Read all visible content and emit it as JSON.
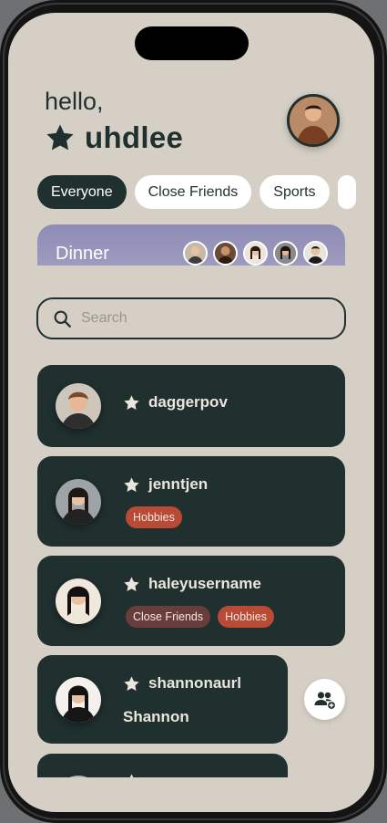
{
  "header": {
    "greeting": "hello,",
    "username": "uhdlee"
  },
  "colors": {
    "primary": "#1f302e",
    "background": "#d6cfc6",
    "group_card": "#9d9bbf",
    "tag_hobbies": "#b84a36",
    "tag_close_friends": "#6a3d3d"
  },
  "filters": [
    {
      "label": "Everyone",
      "active": true
    },
    {
      "label": "Close Friends",
      "active": false
    },
    {
      "label": "Sports",
      "active": false
    }
  ],
  "group_card": {
    "name": "Dinner"
  },
  "search": {
    "placeholder": "Search"
  },
  "friends": [
    {
      "username": "daggerpov",
      "tags": []
    },
    {
      "username": "jenntjen",
      "tags": [
        "Hobbies"
      ]
    },
    {
      "username": "haleyusername",
      "tags": [
        "Close Friends",
        "Hobbies"
      ]
    },
    {
      "username": "shannonaurl",
      "display_name": "Shannon",
      "tags": []
    },
    {
      "username": "",
      "tags": []
    }
  ],
  "icons": {
    "favorite": "star-icon",
    "search": "magnifier-icon",
    "add_friend": "group-add-icon"
  }
}
